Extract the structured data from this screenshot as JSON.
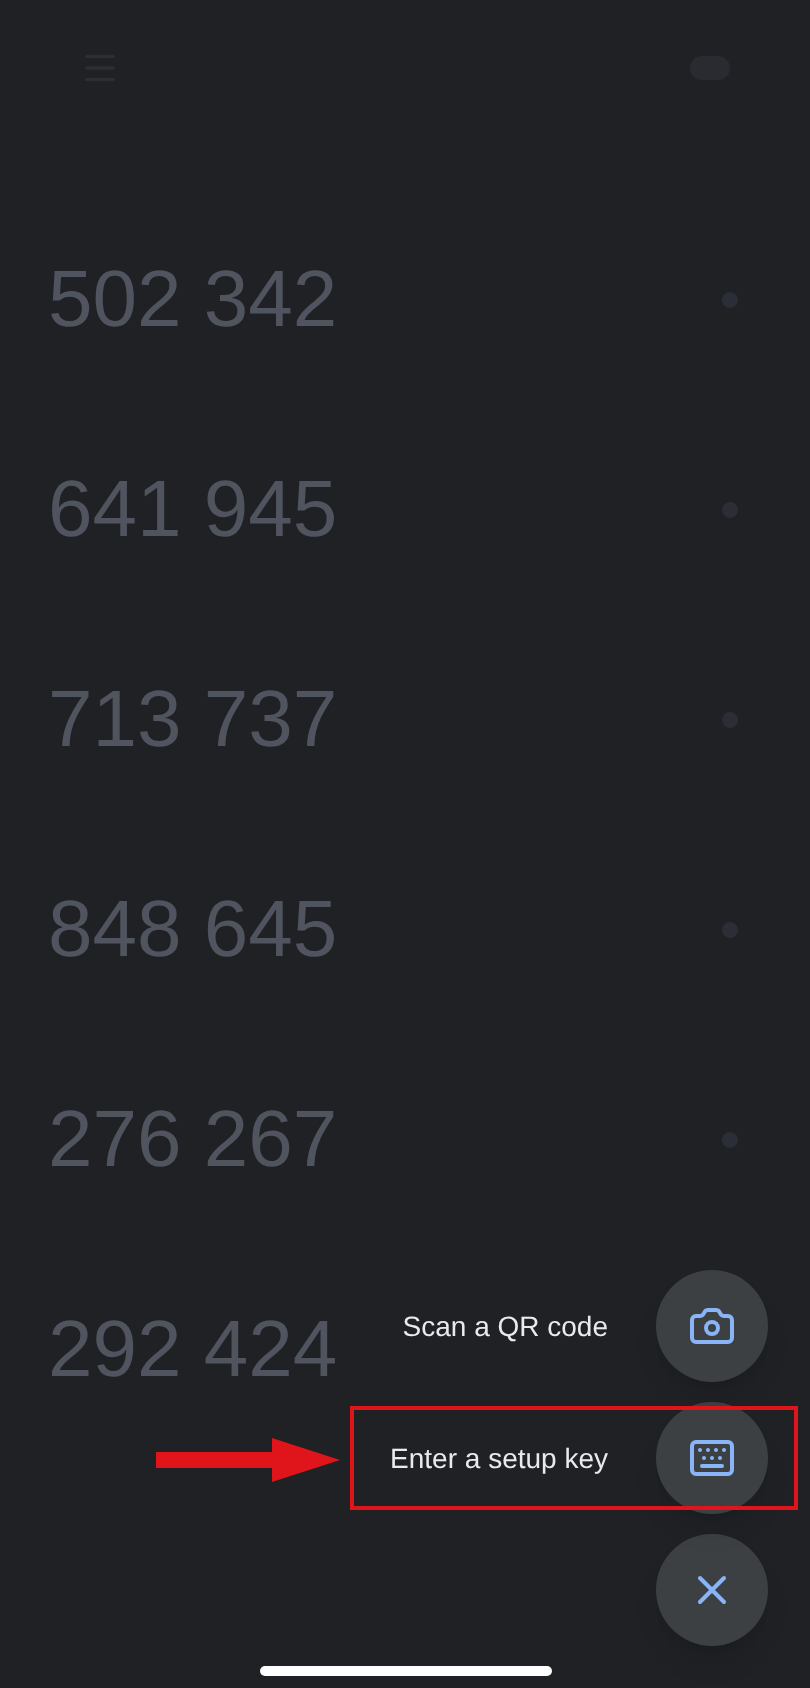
{
  "codes": [
    {
      "code": "502 342",
      "timer": true
    },
    {
      "code": "641 945",
      "timer": true
    },
    {
      "code": "713 737",
      "timer": true
    },
    {
      "code": "848 645",
      "timer": true
    },
    {
      "code": "276 267",
      "timer": true
    },
    {
      "code": "292 424"
    }
  ],
  "fab_menu": {
    "items": [
      {
        "label": "Scan a QR code",
        "kind": "camera",
        "highlighted": false
      },
      {
        "label": "Enter a setup key",
        "kind": "keyboard",
        "highlighted": true
      }
    ]
  }
}
